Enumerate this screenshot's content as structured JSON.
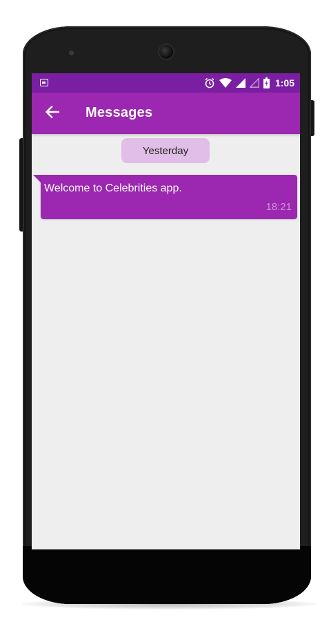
{
  "statusbar": {
    "time": "1:05",
    "icons": [
      "image-notification-icon",
      "alarm-icon",
      "wifi-icon",
      "signal-icon",
      "signal-empty-icon",
      "battery-charging-icon"
    ]
  },
  "appbar": {
    "back_icon": "arrow-back-icon",
    "title": "Messages"
  },
  "conversation": {
    "date_separator": "Yesterday",
    "messages": [
      {
        "text": "Welcome to Celebrities app.",
        "time": "18:21"
      }
    ]
  },
  "colors": {
    "statusbar": "#7b1fa2",
    "primary": "#9c27b0",
    "chip": "#e1bee7",
    "background": "#eeeeee",
    "bubble_time": "#ce93d8"
  }
}
